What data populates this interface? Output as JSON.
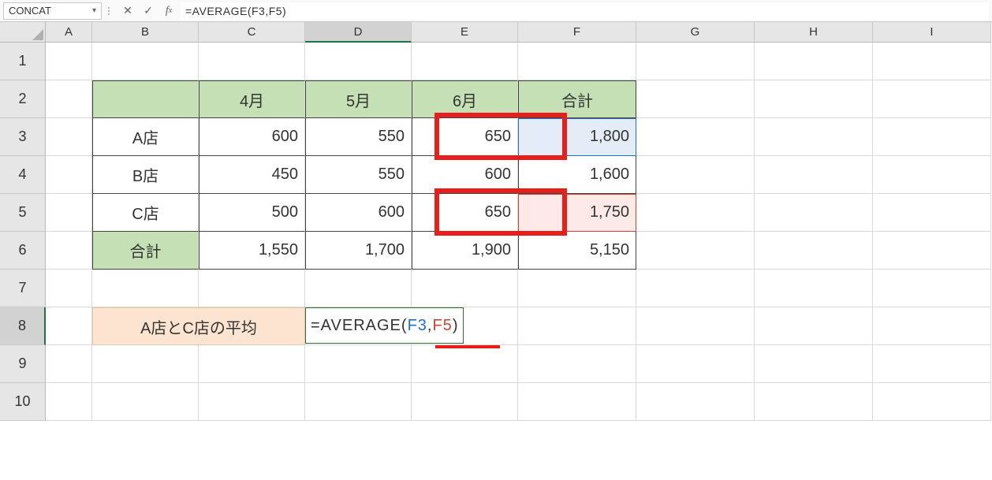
{
  "name_box": "CONCAT",
  "formula_bar": {
    "text": "=AVERAGE(F3,F5)"
  },
  "columns": [
    "A",
    "B",
    "C",
    "D",
    "E",
    "F",
    "G",
    "H",
    "I"
  ],
  "rows": [
    "1",
    "2",
    "3",
    "4",
    "5",
    "6",
    "7",
    "8",
    "9",
    "10"
  ],
  "col_widths": {
    "A": 59,
    "B": 135,
    "C": 135,
    "D": 135,
    "E": 135,
    "F": 150,
    "G": 150,
    "H": 150,
    "I": 150
  },
  "row_heights": {
    "1": 48,
    "2": 48,
    "3": 48,
    "4": 48,
    "5": 48,
    "6": 48,
    "7": 48,
    "8": 48,
    "9": 48,
    "10": 48
  },
  "active_col": "D",
  "active_row": "8",
  "table": {
    "headers": {
      "blank": "",
      "c": "4月",
      "d": "5月",
      "e": "6月",
      "f": "合計"
    },
    "rows": [
      {
        "name": "A店",
        "c": "600",
        "d": "550",
        "e": "650",
        "f": "1,800"
      },
      {
        "name": "B店",
        "c": "450",
        "d": "550",
        "e": "600",
        "f": "1,600"
      },
      {
        "name": "C店",
        "c": "500",
        "d": "600",
        "e": "650",
        "f": "1,750"
      }
    ],
    "total": {
      "name": "合計",
      "c": "1,550",
      "d": "1,700",
      "e": "1,900",
      "f": "5,150"
    }
  },
  "label8": "A店とC店の平均",
  "editing_formula": {
    "prefix": "=AVERAGE(",
    "ref1": "F3",
    "comma": ",",
    "ref2": "F5",
    "suffix": ")"
  },
  "chart_data": {
    "type": "table",
    "title": "",
    "categories": [
      "4月",
      "5月",
      "6月",
      "合計"
    ],
    "series": [
      {
        "name": "A店",
        "values": [
          600,
          550,
          650,
          1800
        ]
      },
      {
        "name": "B店",
        "values": [
          450,
          550,
          600,
          1600
        ]
      },
      {
        "name": "C店",
        "values": [
          500,
          600,
          650,
          1750
        ]
      },
      {
        "name": "合計",
        "values": [
          1550,
          1700,
          1900,
          5150
        ]
      }
    ]
  }
}
